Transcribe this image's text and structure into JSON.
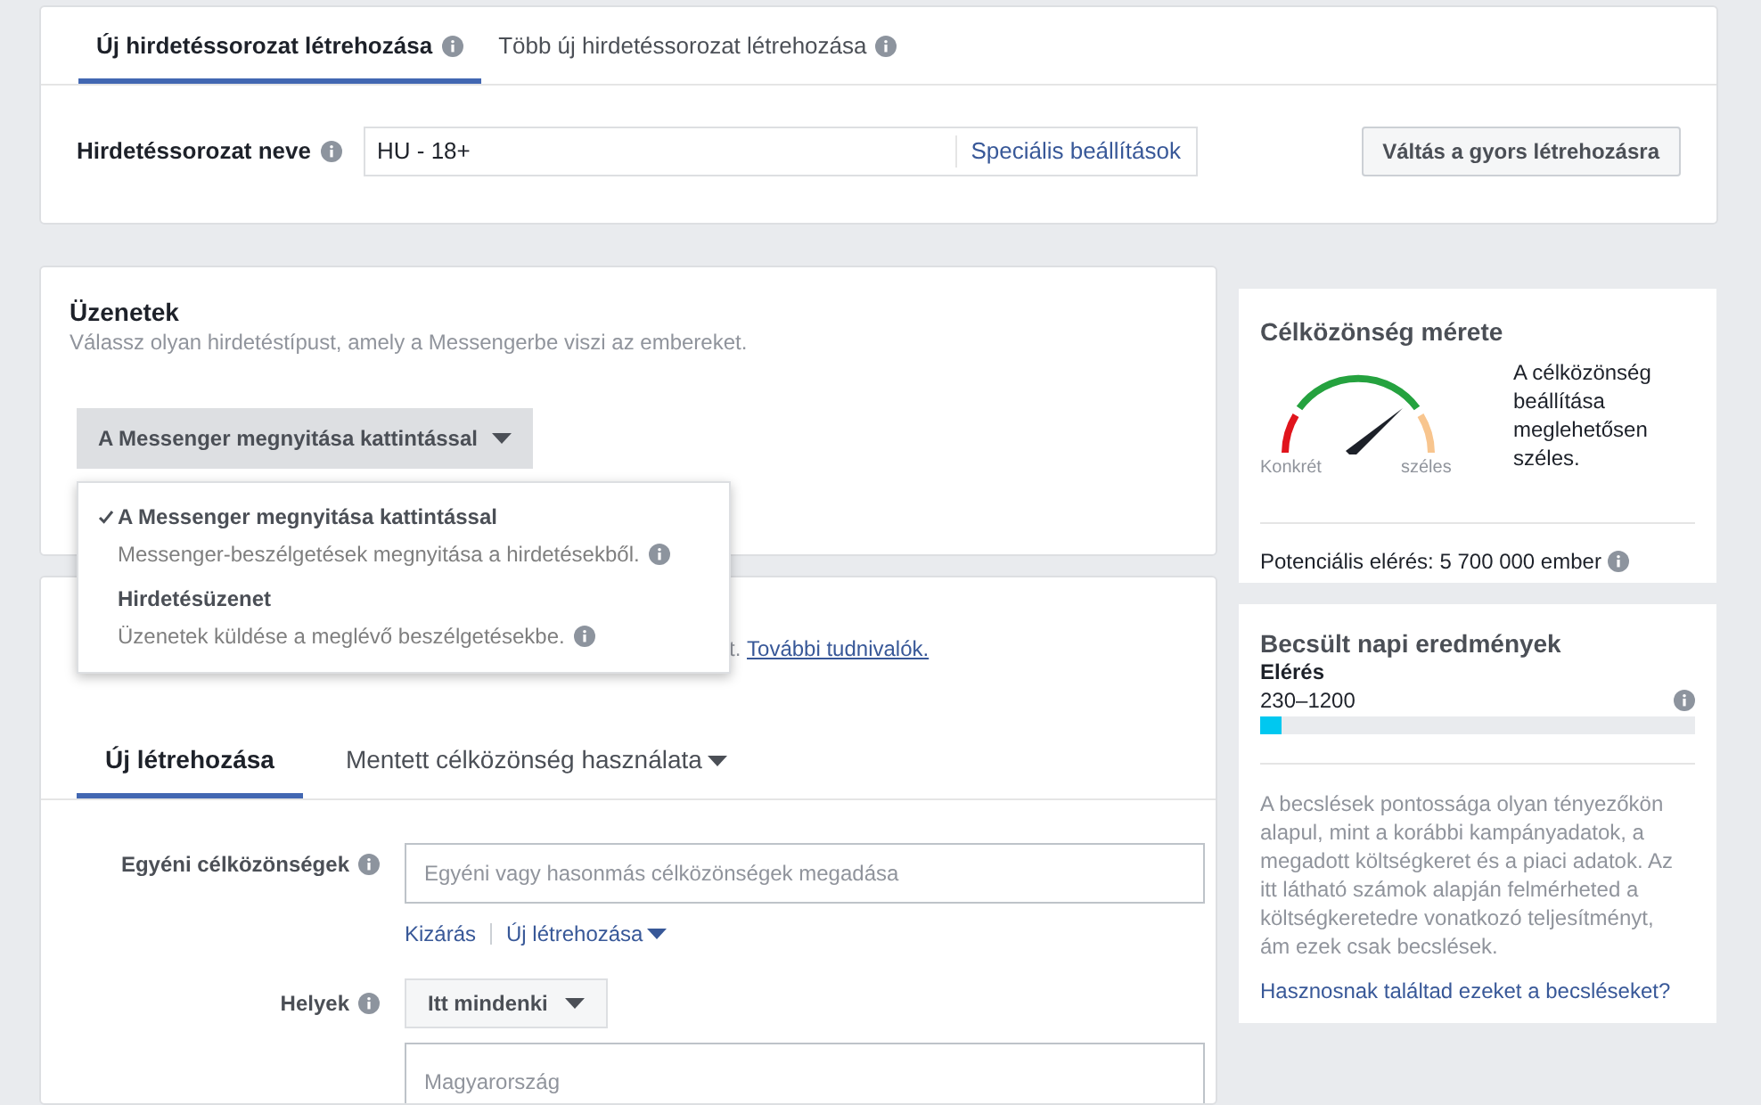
{
  "ad_set_tabs": [
    {
      "label": "Új hirdetéssorozat létrehozása",
      "selected": true
    },
    {
      "label": "Több új hirdetéssorozat létrehozása",
      "selected": false
    }
  ],
  "ad_set_name": {
    "label": "Hirdetéssorozat neve",
    "value": "HU - 18+",
    "link": "Speciális beállítások"
  },
  "quick_create_button": "Váltás a gyors létrehozásra",
  "messages": {
    "title": "Üzenetek",
    "subtitle": "Válassz olyan hirdetéstípust, amely a Messengerbe viszi az embereket.",
    "dropdown": {
      "label": "A Messenger megnyitása kattintással",
      "expanded": true,
      "options": [
        {
          "label": "A Messenger megnyitása kattintással",
          "description": "Messenger-beszélgetések megnyitása a hirdetésekből.",
          "selected": true
        },
        {
          "label": "Hirdetésüzenet",
          "description": "Üzenetek küldése a meglévő beszélgetésekbe.",
          "selected": false
        }
      ]
    }
  },
  "audience": {
    "description_visible_end": "t.",
    "link": "További tudnivalók.",
    "tabs": [
      {
        "label": "Új létrehozása",
        "selected": true,
        "has_menu": false
      },
      {
        "label": "Mentett célközönség használata",
        "selected": false,
        "has_menu": true
      }
    ],
    "custom_audiences": {
      "label": "Egyéni célközönségek",
      "placeholder": "Egyéni vagy hasonmás célközönségek megadása",
      "links": [
        "Kizárás",
        "Új létrehozása"
      ]
    },
    "locations": {
      "label": "Helyek",
      "button": "Itt mindenki",
      "placeholder": "Magyarország"
    }
  },
  "audience_size": {
    "title": "Célközönség mérete",
    "gauge_left": "Konkrét",
    "gauge_right": "széles",
    "summary": "A célközönség beállítása meglehetősen széles.",
    "potential_reach": "Potenciális elérés: 5 700 000 ember"
  },
  "estimated_results": {
    "title": "Becsült napi eredmények",
    "metric": "Elérés",
    "range": "230–1200",
    "level": 0.05,
    "note": "A becslések pontossága olyan tényezőkön alapul, mint a korábbi kampányadatok, a megadott költségkeret és a piaci adatok. Az itt látható számok alapján felmérheted a költségkeretedre vonatkozó teljesítményt, ám ezek csak becslések.",
    "feedback_link": "Hasznosnak találtad ezeket a becsléseket?"
  }
}
